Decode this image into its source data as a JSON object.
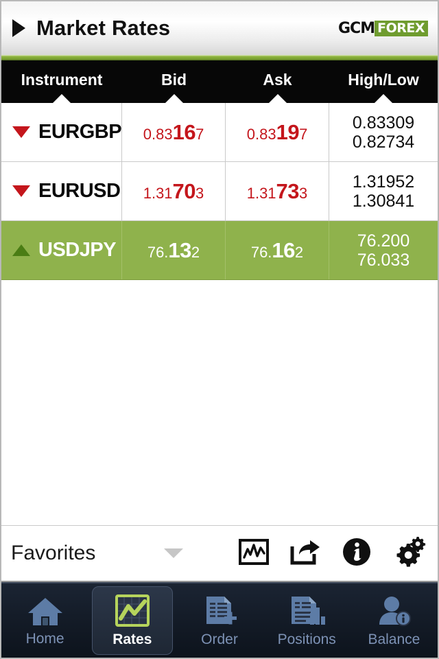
{
  "header": {
    "back_icon": "back-triangle-icon",
    "title": "Market Rates",
    "logo_primary": "GCM",
    "logo_secondary": "FOREX"
  },
  "colors": {
    "accent_green": "#8db33c",
    "row_up_green": "#8fb24c",
    "price_red": "#c4161c",
    "header_black": "#070707",
    "nav_dark": "#141c28"
  },
  "table": {
    "columns": [
      {
        "label": "Instrument",
        "key": "instrument"
      },
      {
        "label": "Bid",
        "key": "bid"
      },
      {
        "label": "Ask",
        "key": "ask"
      },
      {
        "label": "High/Low",
        "key": "highlow"
      }
    ],
    "rows": [
      {
        "symbol": "EURGBP",
        "direction": "down",
        "bid": {
          "pre": "0.83",
          "big": "16",
          "post": "7"
        },
        "ask": {
          "pre": "0.83",
          "big": "19",
          "post": "7"
        },
        "high": "0.83309",
        "low": "0.82734"
      },
      {
        "symbol": "EURUSD",
        "direction": "down",
        "bid": {
          "pre": "1.31",
          "big": "70",
          "post": "3"
        },
        "ask": {
          "pre": "1.31",
          "big": "73",
          "post": "3"
        },
        "high": "1.31952",
        "low": "1.30841"
      },
      {
        "symbol": "USDJPY",
        "direction": "up",
        "bid": {
          "pre": "76.",
          "big": "13",
          "post": "2"
        },
        "ask": {
          "pre": "76.",
          "big": "16",
          "post": "2"
        },
        "high": "76.200",
        "low": "76.033"
      }
    ]
  },
  "favorites_bar": {
    "label": "Favorites",
    "dropdown_icon": "chevron-down-icon",
    "icons": [
      {
        "name": "chart-icon"
      },
      {
        "name": "share-icon"
      },
      {
        "name": "info-icon"
      },
      {
        "name": "settings-gears-icon"
      }
    ]
  },
  "bottom_nav": {
    "items": [
      {
        "label": "Home",
        "icon": "home-icon",
        "active": false
      },
      {
        "label": "Rates",
        "icon": "chart-rates-icon",
        "active": true
      },
      {
        "label": "Order",
        "icon": "order-document-plus-icon",
        "active": false
      },
      {
        "label": "Positions",
        "icon": "positions-report-icon",
        "active": false
      },
      {
        "label": "Balance",
        "icon": "balance-person-info-icon",
        "active": false
      }
    ]
  }
}
